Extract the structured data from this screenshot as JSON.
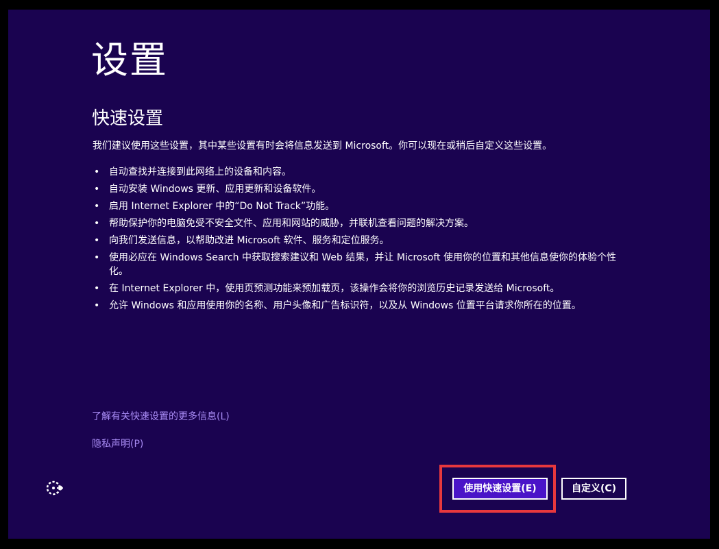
{
  "page": {
    "title": "设置",
    "subtitle": "快速设置",
    "intro": "我们建议使用这些设置，其中某些设置有时会将信息发送到 Microsoft。你可以现在或稍后自定义这些设置。"
  },
  "bullets": [
    "自动查找并连接到此网络上的设备和内容。",
    "自动安装 Windows 更新、应用更新和设备软件。",
    "启用 Internet Explorer 中的“Do Not Track”功能。",
    "帮助保护你的电脑免受不安全文件、应用和网站的威胁，并联机查看问题的解决方案。",
    "向我们发送信息，以帮助改进 Microsoft 软件、服务和定位服务。",
    "使用必应在 Windows Search 中获取搜索建议和 Web 结果，并让 Microsoft 使用你的位置和其他信息使你的体验个性化。",
    "在 Internet Explorer 中，使用页预测功能来预加载页，该操作会将你的浏览历史记录发送给 Microsoft。",
    "允许 Windows 和应用使用你的名称、用户头像和广告标识符，以及从 Windows 位置平台请求你所在的位置。"
  ],
  "links": {
    "learn_more": "了解有关快速设置的更多信息(L)",
    "privacy": "隐私声明(P)"
  },
  "buttons": {
    "express": "使用快速设置(E)",
    "customize": "自定义(C)"
  },
  "icons": {
    "ease_of_access": "ease-of-access-icon"
  },
  "colors": {
    "background": "#1a0350",
    "primary_button": "#4a14c8",
    "link": "#a98cf5",
    "highlight_border": "#e8383d"
  }
}
